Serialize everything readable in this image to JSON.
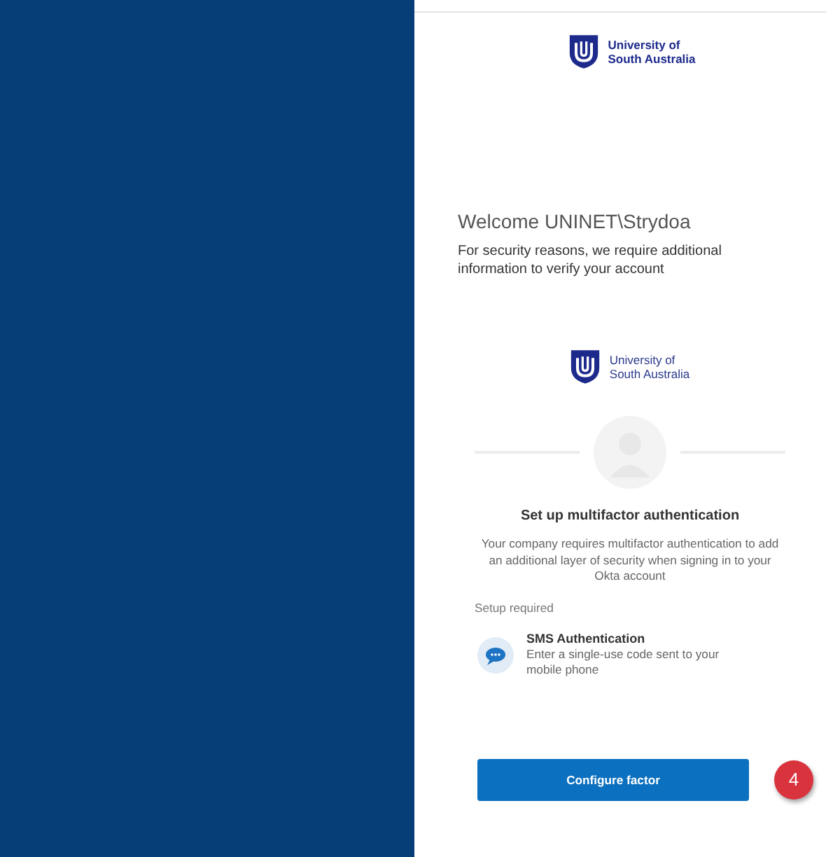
{
  "header_logo": {
    "lines": [
      "University of",
      "South Australia"
    ]
  },
  "welcome": {
    "title": "Welcome UNINET\\Strydoa",
    "message": "For security reasons, we require additional information to verify your account"
  },
  "card": {
    "logo": {
      "lines": [
        "University of",
        "South Australia"
      ]
    },
    "title": "Set up multifactor authentication",
    "description": "Your company requires multifactor authentication to add an additional layer of security when signing in to your Okta account",
    "section_label": "Setup required",
    "factors": [
      {
        "kind": "sms",
        "name": "SMS Authentication",
        "description": "Enter a single-use code sent to your mobile phone"
      }
    ],
    "button": "Configure factor"
  },
  "callout": {
    "label": "4"
  }
}
